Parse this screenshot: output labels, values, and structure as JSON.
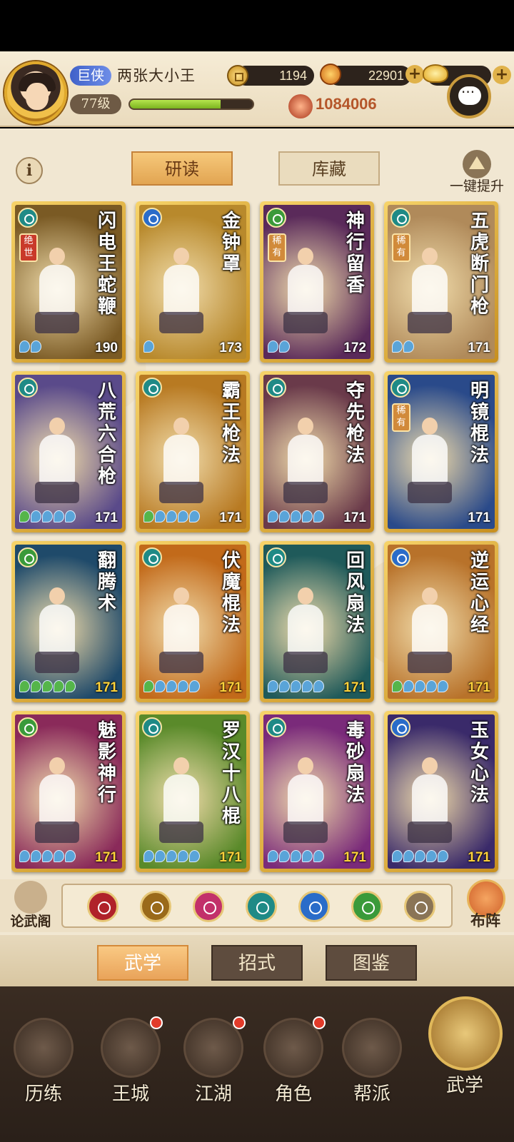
{
  "header": {
    "title_badge": "巨侠",
    "player_name": "两张大小王",
    "level": "77级",
    "exp_fraction": 0.74,
    "coins": "1194",
    "orbs": "22901",
    "combat_power": "1084006"
  },
  "main": {
    "tab_study": "研读",
    "tab_storage": "库藏",
    "upgrade_all": "一键提升"
  },
  "cards": [
    {
      "name": "闪电王蛇鞭",
      "level": "190",
      "type": "fan",
      "type_color": "#1f8a86",
      "rarity": "绝世",
      "rarity_color": "red",
      "dots": [
        "b",
        "b"
      ],
      "bg": "#7a5a24"
    },
    {
      "name": "金钟罩",
      "level": "173",
      "type": "yinyang",
      "type_color": "#2a6cc9",
      "rarity": "",
      "dots": [
        "b"
      ],
      "bg": "#b8892c"
    },
    {
      "name": "神行留香",
      "level": "172",
      "type": "gourd",
      "type_color": "#3a9a3a",
      "rarity": "稀有",
      "dots": [
        "b",
        "b"
      ],
      "bg": "#5a2a5a"
    },
    {
      "name": "五虎断门枪",
      "level": "171",
      "type": "fan",
      "type_color": "#1f8a86",
      "rarity": "稀有",
      "dots": [
        "b",
        "b"
      ],
      "bg": "#b08a5a"
    },
    {
      "name": "八荒六合枪",
      "level": "171",
      "type": "fan",
      "type_color": "#1f8a86",
      "rarity": "",
      "dots": [
        "g",
        "b",
        "b",
        "b",
        "b"
      ],
      "bg": "#5a4a8a"
    },
    {
      "name": "霸王枪法",
      "level": "171",
      "type": "fan",
      "type_color": "#1f8a86",
      "rarity": "",
      "dots": [
        "g",
        "b",
        "b",
        "b",
        "b"
      ],
      "bg": "#b87a22"
    },
    {
      "name": "夺先枪法",
      "level": "171",
      "type": "fan",
      "type_color": "#1f8a86",
      "rarity": "",
      "dots": [
        "b",
        "b",
        "b",
        "b",
        "b"
      ],
      "bg": "#6a3a4a"
    },
    {
      "name": "明镜棍法",
      "level": "171",
      "type": "fan",
      "type_color": "#1f8a86",
      "rarity": "稀有",
      "dots": [],
      "bg": "#2a4a8a"
    },
    {
      "name": "翻腾术",
      "level": "171",
      "type": "gourd",
      "type_color": "#3a9a3a",
      "rarity": "",
      "dots": [
        "g",
        "g",
        "g",
        "g",
        "g"
      ],
      "bg": "#1f4a6a",
      "gold": true
    },
    {
      "name": "伏魔棍法",
      "level": "171",
      "type": "fan",
      "type_color": "#1f8a86",
      "rarity": "",
      "dots": [
        "g",
        "b",
        "b",
        "b",
        "b"
      ],
      "bg": "#c26a1a",
      "gold": true
    },
    {
      "name": "回风扇法",
      "level": "171",
      "type": "fan",
      "type_color": "#1f8a86",
      "rarity": "",
      "dots": [
        "b",
        "b",
        "b",
        "b",
        "b"
      ],
      "bg": "#1f5a5a",
      "gold": true
    },
    {
      "name": "逆运心经",
      "level": "171",
      "type": "yinyang",
      "type_color": "#2a6cc9",
      "rarity": "",
      "dots": [
        "g",
        "b",
        "b",
        "b",
        "b"
      ],
      "bg": "#b8722a",
      "gold": true
    },
    {
      "name": "魅影神行",
      "level": "171",
      "type": "gourd",
      "type_color": "#3a9a3a",
      "rarity": "",
      "dots": [
        "b",
        "b",
        "b",
        "b",
        "b"
      ],
      "bg": "#8a2a5a",
      "gold": true
    },
    {
      "name": "罗汉十八棍",
      "level": "171",
      "type": "fan",
      "type_color": "#1f8a86",
      "rarity": "",
      "dots": [
        "b",
        "b",
        "b",
        "b",
        "b"
      ],
      "bg": "#5a8a2a",
      "gold": true
    },
    {
      "name": "毒砂扇法",
      "level": "171",
      "type": "fan",
      "type_color": "#1f8a86",
      "rarity": "",
      "dots": [
        "b",
        "b",
        "b",
        "b",
        "b"
      ],
      "bg": "#7a2a7a",
      "gold": true
    },
    {
      "name": "玉女心法",
      "level": "171",
      "type": "yinyang",
      "type_color": "#2a6cc9",
      "rarity": "",
      "dots": [
        "b",
        "b",
        "b",
        "b",
        "b"
      ],
      "bg": "#3a2a6a",
      "gold": true
    }
  ],
  "filters": [
    {
      "icon": "sword-filter-icon",
      "color": "#b0222a"
    },
    {
      "icon": "spear-filter-icon",
      "color": "#9a6a1a"
    },
    {
      "icon": "fist-filter-icon",
      "color": "#c2306a"
    },
    {
      "icon": "fan-filter-icon",
      "color": "#1f8a86"
    },
    {
      "icon": "yinyang-filter-icon",
      "color": "#2a6cc9"
    },
    {
      "icon": "gourd-filter-icon",
      "color": "#3a9a3a"
    },
    {
      "icon": "arrow-up-filter-icon",
      "color": "#8a7456"
    }
  ],
  "filter_bar": {
    "discuss": "论武阁",
    "formation": "布阵"
  },
  "subtabs": {
    "martial": "武学",
    "moves": "招式",
    "codex": "图鉴"
  },
  "nav": [
    {
      "label": "历练",
      "badge": false
    },
    {
      "label": "王城",
      "badge": true
    },
    {
      "label": "江湖",
      "badge": true
    },
    {
      "label": "角色",
      "badge": true
    },
    {
      "label": "帮派",
      "badge": false
    },
    {
      "label": "武学",
      "badge": false
    }
  ]
}
